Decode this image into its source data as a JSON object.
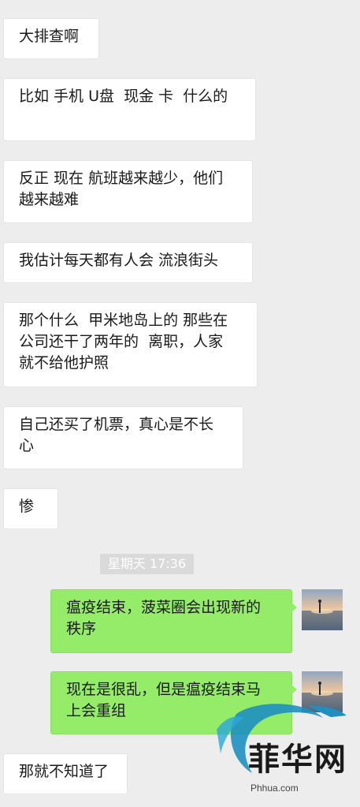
{
  "messages": [
    {
      "side": "in",
      "text": "大排查啊"
    },
    {
      "side": "in",
      "text": "比如 手机 U盘  现金 卡  什么的"
    },
    {
      "side": "in",
      "text": "反正 现在 航班越来越少，他们\n越来越难"
    },
    {
      "side": "in",
      "text": "我估计每天都有人会 流浪街头"
    },
    {
      "side": "in",
      "text": "那个什么  甲米地岛上的 那些在\n公司还干了两年的  离职，人家\n就不给他护照"
    },
    {
      "side": "in",
      "text": "自己还买了机票，真心是不长\n心"
    },
    {
      "side": "in",
      "text": "惨"
    },
    {
      "side": "out",
      "text": "瘟疫结束，菠菜圈会出现新的\n秩序"
    },
    {
      "side": "out",
      "text": "现在是很乱，但是瘟疫结束马\n上会重组"
    },
    {
      "side": "in",
      "text": "那就不知道了"
    }
  ],
  "timestamp": "星期天 17:36",
  "watermark": {
    "brand": "菲华网",
    "url": "Phhua.com"
  },
  "colors": {
    "background": "#ededed",
    "incoming_bubble": "#ffffff",
    "outgoing_bubble": "#95ec69"
  },
  "icons": {
    "avatar": "beach-sunset-avatar"
  }
}
